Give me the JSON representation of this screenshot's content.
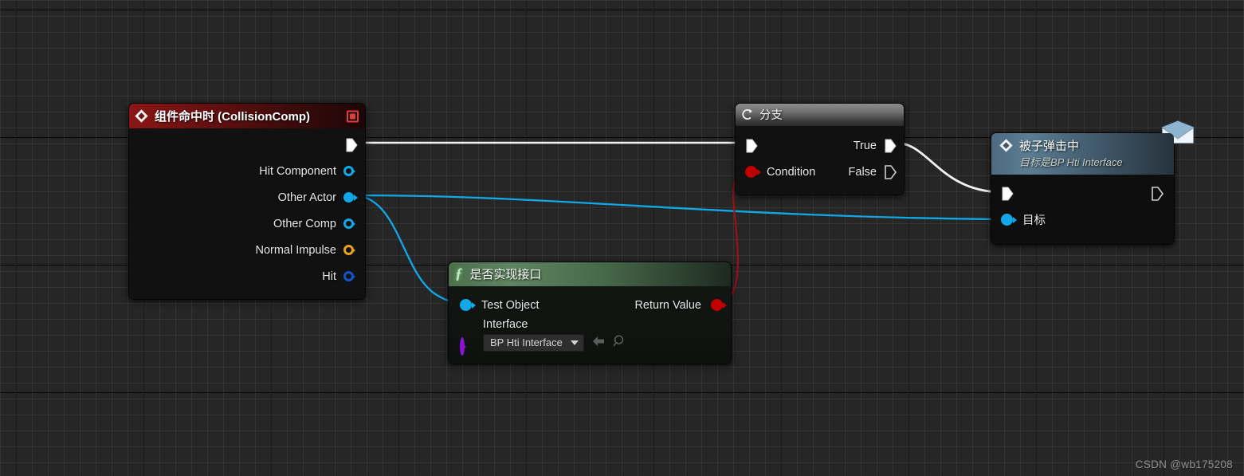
{
  "app": {
    "kind": "blueprint-graph-editor",
    "background_color": "#262626",
    "grid_minor_color": "#787878",
    "grid_major_color": "#000000"
  },
  "watermark": {
    "text": "CSDN @wb175208"
  },
  "colors": {
    "exec_white": "#ffffff",
    "object_cyan": "#12a8e8",
    "struct_blue": "#1255c8",
    "vector_yellow": "#e8a21c",
    "bool_red": "#c00000",
    "interface_purple": "#8a13d6",
    "event_red": "#8c1616",
    "function_green": "#5f8560",
    "message_blue": "#5b7d93",
    "branch_gray": "#8d8d8d"
  },
  "nodes": {
    "event": {
      "title": "组件命中时 (CollisionComp)",
      "icon": "event-diamond-icon",
      "delegate_pin": "delegate-output-pin",
      "pins": [
        {
          "label": "",
          "type": "exec",
          "dir": "out",
          "pin_name": "exec-out-pin"
        },
        {
          "label": "Hit Component",
          "type": "object",
          "dir": "out",
          "pin_name": "hit-component-pin"
        },
        {
          "label": "Other Actor",
          "type": "object",
          "dir": "out",
          "pin_name": "other-actor-pin"
        },
        {
          "label": "Other Comp",
          "type": "object",
          "dir": "out",
          "pin_name": "other-comp-pin"
        },
        {
          "label": "Normal Impulse",
          "type": "vector",
          "dir": "out",
          "pin_name": "normal-impulse-pin"
        },
        {
          "label": "Hit",
          "type": "struct",
          "dir": "out",
          "pin_name": "hit-pin"
        }
      ]
    },
    "branch": {
      "title": "分支",
      "icon": "branch-icon",
      "pins": {
        "exec_in": "",
        "condition": "Condition",
        "true_label": "True",
        "false_label": "False"
      }
    },
    "function": {
      "title": "是否实现接口",
      "icon": "function-f-icon",
      "pins": {
        "test_object": "Test Object",
        "return_value": "Return Value",
        "interface_label": "Interface"
      },
      "interface_dropdown": {
        "value": "BP Hti Interface",
        "browse_icon": "magnifier-icon",
        "use_selected_icon": "arrow-left-icon"
      }
    },
    "message": {
      "title": "被子弹击中",
      "subtitle": "目标是BP Hti Interface",
      "icon": "event-diamond-icon",
      "badge_icon": "envelope-icon",
      "pins": {
        "exec_in": "",
        "exec_out": "",
        "target": "目标"
      }
    }
  },
  "wires": [
    {
      "name": "event-exec-to-branch-exec",
      "color": "#ffffff",
      "kind": "exec"
    },
    {
      "name": "other-actor-to-test-object",
      "color": "#12a8e8",
      "kind": "data"
    },
    {
      "name": "other-actor-to-message-target",
      "color": "#12a8e8",
      "kind": "data"
    },
    {
      "name": "return-value-to-condition",
      "color": "#9e1118",
      "kind": "data"
    },
    {
      "name": "branch-true-to-message-exec",
      "color": "#ffffff",
      "kind": "exec"
    }
  ]
}
